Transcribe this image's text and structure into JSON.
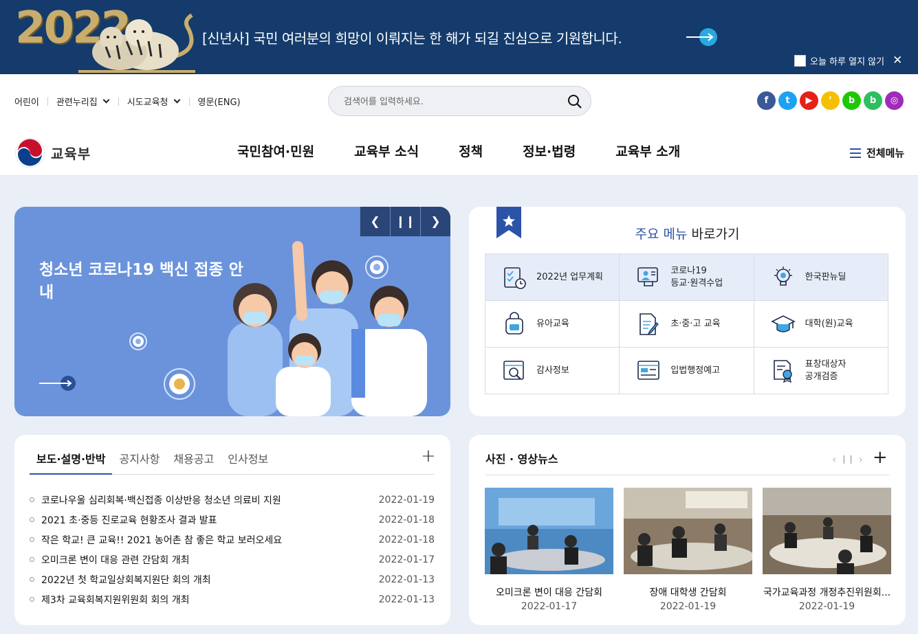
{
  "top_banner": {
    "year": "2022",
    "message": "[신년사] 국민 여러분의 희망이 이뤄지는 한 해가 되길 진심으로 기원합니다.",
    "close_today_label": "오늘 하루 열지 않기",
    "close_icon": "✕",
    "bg_color": "#143b6b"
  },
  "utility_nav": {
    "items": [
      "어린이",
      "관련누리집",
      "시도교육청",
      "영문(ENG)"
    ]
  },
  "search": {
    "placeholder": "검색어를 입력하세요."
  },
  "sns": {
    "items": [
      {
        "name": "facebook",
        "glyph": "f",
        "color": "#3b5998"
      },
      {
        "name": "twitter",
        "glyph": "t",
        "color": "#1da1f2"
      },
      {
        "name": "youtube",
        "glyph": "▶",
        "color": "#e62117"
      },
      {
        "name": "kakao-story",
        "glyph": "ʼ",
        "color": "#f5c000"
      },
      {
        "name": "blog",
        "glyph": "b",
        "color": "#1ec800"
      },
      {
        "name": "band",
        "glyph": "b",
        "color": "#2dbe60"
      },
      {
        "name": "instagram",
        "glyph": "◎",
        "color": "#a02ab9"
      }
    ]
  },
  "logo": {
    "text": "교육부"
  },
  "gnb": {
    "items": [
      "국민참여·민원",
      "교육부 소식",
      "정책",
      "정보·법령",
      "교육부 소개"
    ]
  },
  "all_menu_label": "전체메뉴",
  "slider": {
    "title": "청소년 코로나19 백신 접종 안내",
    "bg_color": "#6b93dc"
  },
  "main_menu": {
    "title_highlight": "주요 메뉴",
    "title_rest": " 바로가기",
    "items": [
      {
        "label": "2022년 업무계획",
        "icon": "checklist-icon"
      },
      {
        "label": "코로나19\n등교·원격수업",
        "icon": "online-class-icon"
      },
      {
        "label": "한국판뉴딜",
        "icon": "lightbulb-icon"
      },
      {
        "label": "유아교육",
        "icon": "backpack-icon"
      },
      {
        "label": "초·중·고 교육",
        "icon": "document-pencil-icon"
      },
      {
        "label": "대학(원)교육",
        "icon": "graduation-cap-icon"
      },
      {
        "label": "감사정보",
        "icon": "magnifier-browser-icon"
      },
      {
        "label": "입법행정예고",
        "icon": "form-icon"
      },
      {
        "label": "표창대상자\n공개검증",
        "icon": "certificate-icon"
      }
    ]
  },
  "news": {
    "tabs": [
      "보도·설명·반박",
      "공지사항",
      "채용공고",
      "인사정보"
    ],
    "items": [
      {
        "title": "코로나우울 심리회복·백신접종 이상반응 청소년 의료비 지원",
        "date": "2022-01-19"
      },
      {
        "title": "2021 초·중등 진로교육 현황조사 결과 발표",
        "date": "2022-01-18"
      },
      {
        "title": "작은 학교! 큰 교육!! 2021 농어촌 참 좋은 학교 보러오세요",
        "date": "2022-01-18"
      },
      {
        "title": "오미크론 변이 대응 관련 간담회 개최",
        "date": "2022-01-17"
      },
      {
        "title": " 2022년 첫 학교일상회복지원단 회의 개최",
        "date": "2022-01-13"
      },
      {
        "title": "제3차 교육회복지원위원회 회의 개최",
        "date": "2022-01-13"
      }
    ]
  },
  "photo_news": {
    "title": "사진 · 영상뉴스",
    "items": [
      {
        "caption": "오미크론 변이 대응 간담회",
        "date": "2022-01-17"
      },
      {
        "caption": "장애 대학생 간담회",
        "date": "2022-01-19"
      },
      {
        "caption": "국가교육과정 개정추진위원회...",
        "date": "2022-01-19"
      }
    ]
  },
  "accent_color": "#2b53a7"
}
